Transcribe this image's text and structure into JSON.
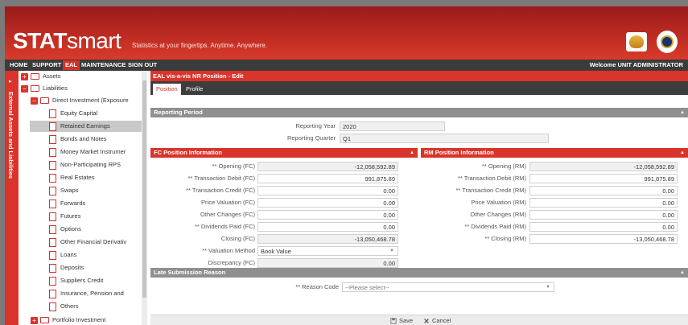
{
  "header": {
    "logo_bold": "STAT",
    "logo_rest": "smart",
    "tagline": "Statistics at your fingertips. Anytime. Anywhere."
  },
  "nav": {
    "items": [
      "HOME",
      "SUPPORT",
      "EAL",
      "MAINTENANCE",
      "SIGN OUT"
    ],
    "active": "EAL",
    "welcome": "Welcome UNIT ADMINISTRATOR"
  },
  "sidebar": {
    "collapse_arrow": "▸",
    "vertical_label": "External Assets and Liabilities"
  },
  "tree": {
    "assets": "Assets",
    "liabilities": "Liabilities",
    "direct_investment": "Direct Investment (Exposure",
    "children": [
      "Equity Capital",
      "Retained Earnings",
      "Bonds and Notes",
      "Money Market Instrumer",
      "Non-Participating RPS",
      "Real Estates",
      "Swaps",
      "Forwards",
      "Futures",
      "Options",
      "Other Financial Derivativ",
      "Loans",
      "Deposits",
      "Suppliers Credit",
      "Insurance, Pension and",
      "Others"
    ],
    "portfolio": "Portfolio Investment",
    "selected": "Retained Earnings"
  },
  "main": {
    "title": "EAL vis-a-vis NR Position - Edit",
    "tabs": [
      "Position",
      "Profile"
    ],
    "reporting_period": {
      "header": "Reporting Period",
      "year_label": "Reporting Year",
      "year_value": "2020",
      "quarter_label": "Reporting Quarter",
      "quarter_value": "Q1"
    },
    "fc": {
      "header": "FC Position Information",
      "rows": [
        {
          "label": "** Opening (FC)",
          "value": "-12,058,592.89"
        },
        {
          "label": "** Transaction Debit (FC)",
          "value": "991,875.89"
        },
        {
          "label": "** Transaction Credit (FC)",
          "value": "0.00"
        },
        {
          "label": "Price Valuation (FC)",
          "value": "0.00"
        },
        {
          "label": "Other Changes (FC)",
          "value": "0.00"
        },
        {
          "label": "** Dividends Paid (FC)",
          "value": "0.00"
        },
        {
          "label": "Closing (FC)",
          "value": "-13,050,468.78"
        },
        {
          "label": "** Valuation Method",
          "value": "Book Value"
        },
        {
          "label": "Discrepancy (FC)",
          "value": "0.00"
        }
      ]
    },
    "rm": {
      "header": "RM Position Information",
      "rows": [
        {
          "label": "** Opening (RM)",
          "value": "-12,058,592.89"
        },
        {
          "label": "** Transaction Debit (RM)",
          "value": "991,875.89"
        },
        {
          "label": "** Transaction Credit (RM)",
          "value": "0.00"
        },
        {
          "label": "Price Valuation (RM)",
          "value": "0.00"
        },
        {
          "label": "Other Changes (RM)",
          "value": "0.00"
        },
        {
          "label": "** Dividends Paid (RM)",
          "value": "0.00"
        },
        {
          "label": "** Closing (RM)",
          "value": "-13,050,468.78"
        }
      ]
    },
    "late": {
      "header": "Late Submission Reason",
      "label": "** Reason Code",
      "placeholder": "--Please select--"
    },
    "collapse_glyph": "▲",
    "dropdown_glyph": "▼"
  },
  "footer": {
    "save": "Save",
    "cancel": "Cancel"
  },
  "colors": {
    "brand_red": "#d9342b",
    "nav_dark": "#3b3b3b",
    "section_gray": "#8f8f8f"
  }
}
